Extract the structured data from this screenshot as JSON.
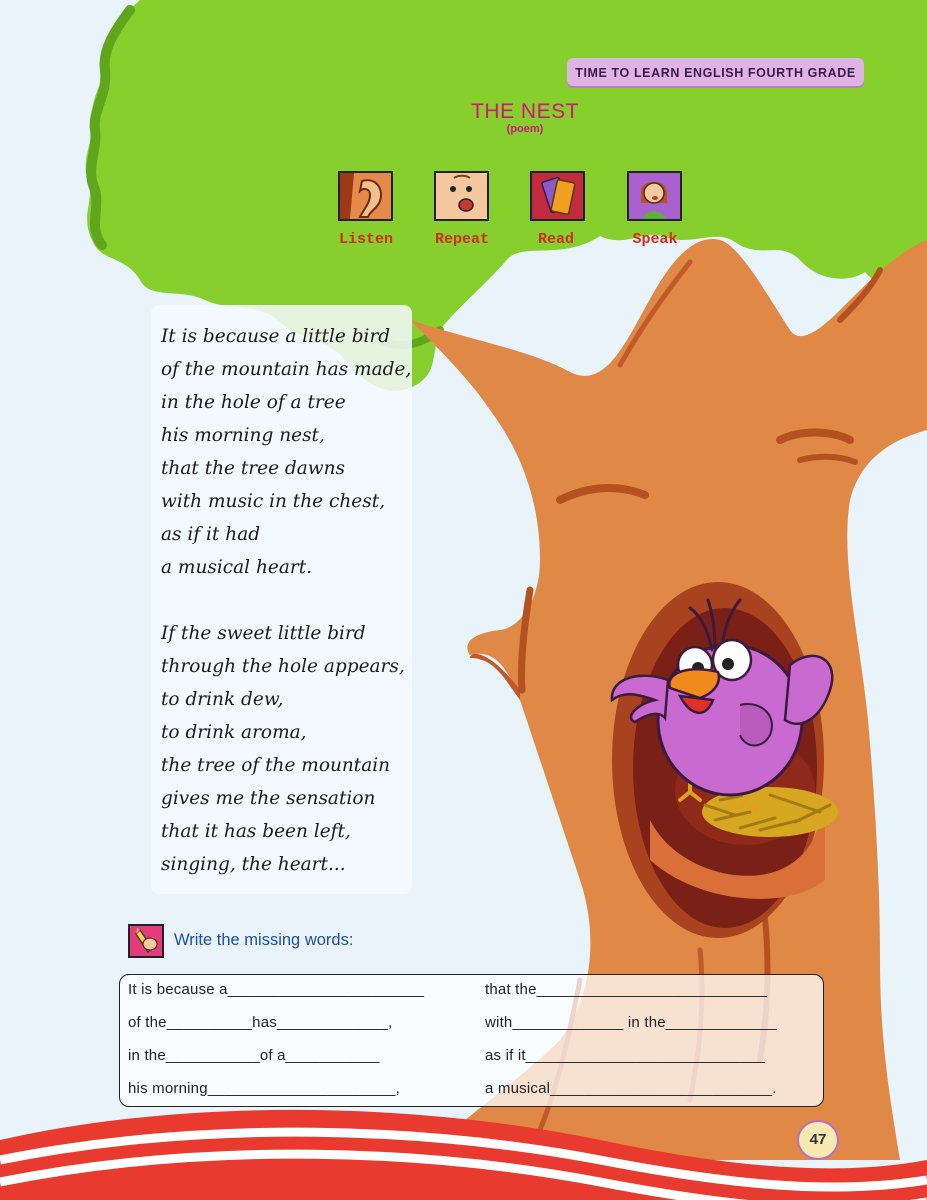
{
  "header": {
    "series_label": "TIME TO LEARN ENGLISH FOURTH GRADE"
  },
  "title": {
    "main": "THE NEST",
    "sub": "(poem)"
  },
  "activities": [
    {
      "label": "Listen",
      "icon": "ear-icon"
    },
    {
      "label": "Repeat",
      "icon": "talking-face-icon"
    },
    {
      "label": "Read",
      "icon": "books-icon"
    },
    {
      "label": "Speak",
      "icon": "girl-speaking-icon"
    }
  ],
  "poem": {
    "lines": [
      "It is because a little bird",
      "of the mountain has made,",
      "in the hole of a tree",
      "his morning nest,",
      "that the tree dawns",
      "with music in the chest,",
      "as if it had",
      "a musical heart.",
      "If the sweet little bird",
      "through the hole appears,",
      "to drink dew,",
      "to drink aroma,",
      "the tree of the mountain",
      "gives me the sensation",
      "that it has been left,",
      "singing, the heart..."
    ]
  },
  "exercise": {
    "instruction": "Write the missing words:",
    "left": [
      "It is because a_______________________",
      "of  the__________has_____________,",
      "in  the___________of  a___________",
      "his  morning______________________,"
    ],
    "right": [
      "that  the___________________________",
      "with_____________ in the_____________",
      "as if it____________________________",
      "a musical__________________________."
    ]
  },
  "page_number": "47",
  "colors": {
    "title": "#d1157a",
    "activity_label": "#d42b1e",
    "instruction": "#1f4fa3",
    "foliage": "#86cf2c",
    "trunk": "#e08845",
    "bird": "#c96ad0",
    "header_pill": "#e0b3e7"
  }
}
